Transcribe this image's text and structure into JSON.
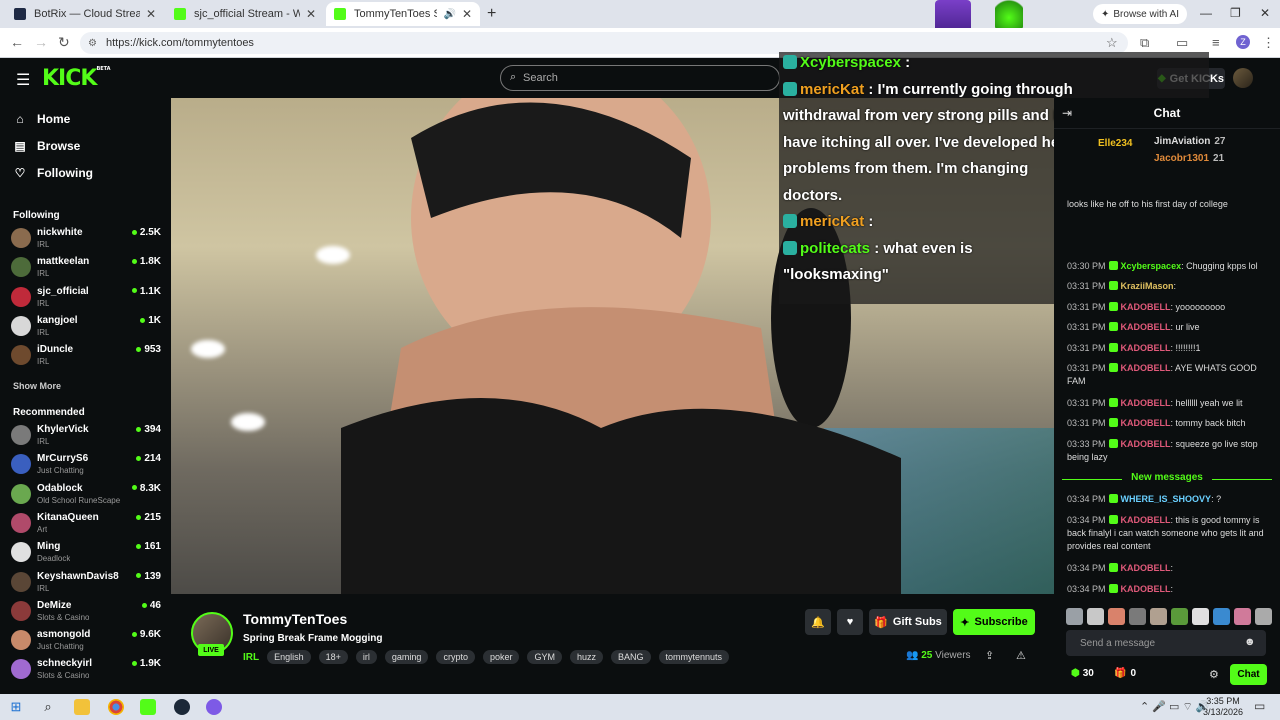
{
  "browser": {
    "tabs": [
      {
        "title": "BotRix — Cloud Streaming Bot",
        "fav_color": "#1f2a44"
      },
      {
        "title": "sjc_official Stream - Watch Live",
        "fav_color": "#53fc18"
      },
      {
        "title": "TommyTenToes Stream - Watch Live",
        "fav_color": "#53fc18"
      }
    ],
    "ai_button": "Browse with AI",
    "url": "https://kick.com/tommytentoes",
    "profile_initial": "Z"
  },
  "kick": {
    "logo": "KICK",
    "logo_beta": "BETA",
    "search_placeholder": "Search",
    "get_kicks": "Get KICKs"
  },
  "sidebar": {
    "nav": [
      "Home",
      "Browse",
      "Following"
    ],
    "following_title": "Following",
    "following": [
      {
        "name": "nickwhite",
        "category": "IRL",
        "viewers": "2.5K",
        "color": "#8a6b4e"
      },
      {
        "name": "mattkeelan",
        "category": "IRL",
        "viewers": "1.8K",
        "color": "#4d6b3a"
      },
      {
        "name": "sjc_official",
        "category": "IRL",
        "viewers": "1.1K",
        "color": "#c02a3a"
      },
      {
        "name": "kangjoel",
        "category": "IRL",
        "viewers": "1K",
        "color": "#d8d8d8"
      },
      {
        "name": "iDuncle",
        "category": "IRL",
        "viewers": "953",
        "color": "#6e4a2e"
      }
    ],
    "show_more": "Show More",
    "recommended_title": "Recommended",
    "recommended": [
      {
        "name": "KhylerVick",
        "category": "IRL",
        "viewers": "394",
        "color": "#7a7a7a"
      },
      {
        "name": "MrCurryS6",
        "category": "Just Chatting",
        "viewers": "214",
        "color": "#3a5fbf"
      },
      {
        "name": "Odablock",
        "category": "Old School RuneScape",
        "viewers": "8.3K",
        "color": "#6aa84f"
      },
      {
        "name": "KitanaQueen",
        "category": "Art",
        "viewers": "215",
        "color": "#b04a6a"
      },
      {
        "name": "Ming",
        "category": "Deadlock",
        "viewers": "161",
        "color": "#e0e0e0"
      },
      {
        "name": "KeyshawnDavis8",
        "category": "IRL",
        "viewers": "139",
        "color": "#5a4636"
      },
      {
        "name": "DeMize",
        "category": "Slots & Casino",
        "viewers": "46",
        "color": "#8b3a3a"
      },
      {
        "name": "asmongold",
        "category": "Just Chatting",
        "viewers": "9.6K",
        "color": "#c88a6a"
      },
      {
        "name": "schneckyirl",
        "category": "Slots & Casino",
        "viewers": "1.9K",
        "color": "#a06ad0"
      }
    ]
  },
  "overlay": {
    "lines": [
      {
        "user": "Xcyberspacex",
        "text": " :",
        "color": "#53fc18"
      },
      {
        "user": "mericKat",
        "text": " : I'm currently going through",
        "color": "#f0a020"
      },
      {
        "user": "",
        "text": "withdrawal from very strong pills and I",
        "color": "#fff"
      },
      {
        "user": "",
        "text": "have itching all over. I've developed heart",
        "color": "#fff"
      },
      {
        "user": "",
        "text": "problems from them. I'm changing",
        "color": "#fff"
      },
      {
        "user": "",
        "text": "doctors.",
        "color": "#fff"
      },
      {
        "user": "mericKat",
        "text": " :",
        "color": "#f0a020"
      },
      {
        "user": "politecats",
        "text": " : what even is",
        "color": "#53fc18"
      },
      {
        "user": "",
        "text": "\"looksmaxing\"",
        "color": "#fff"
      }
    ]
  },
  "stream": {
    "name": "TommyTenToes",
    "title": "Spring Break Frame Mogging",
    "live": "LIVE",
    "category": "IRL",
    "tags": [
      "English",
      "18+",
      "irl",
      "gaming",
      "crypto",
      "poker",
      "GYM",
      "huzz",
      "BANG",
      "tommytennuts"
    ],
    "gift_subs": "Gift Subs",
    "subscribe": "Subscribe",
    "viewers_count": "25",
    "viewers_label": "Viewers"
  },
  "chat": {
    "title": "Chat",
    "gifters": [
      {
        "name": "Elle234",
        "count": "",
        "color": "#f0c020"
      },
      {
        "name": "JimAviation",
        "count": "27",
        "color": "#ddd"
      },
      {
        "name": "Jacobr1301",
        "count": "21",
        "color": "#e08a3a"
      }
    ],
    "messages": [
      {
        "ts": "",
        "user": "",
        "text": "looks like he off to his first day of college",
        "color": "#ddd"
      },
      {
        "ts": "03:30 PM",
        "user": "Xcyberspacex",
        "text": ": Chugging kpps lol",
        "color": "#53fc18"
      },
      {
        "ts": "03:31 PM",
        "user": "KraziiMason",
        "text": ":",
        "color": "#e0c060"
      },
      {
        "ts": "03:31 PM",
        "user": "KADOBELL",
        "text": ": yooooooooo",
        "color": "#e05a7a"
      },
      {
        "ts": "03:31 PM",
        "user": "KADOBELL",
        "text": ": ur live",
        "color": "#e05a7a"
      },
      {
        "ts": "03:31 PM",
        "user": "KADOBELL",
        "text": ": !!!!!!!!1",
        "color": "#e05a7a"
      },
      {
        "ts": "03:31 PM",
        "user": "KADOBELL",
        "text": ": AYE WHATS GOOD FAM",
        "color": "#e05a7a"
      },
      {
        "ts": "03:31 PM",
        "user": "KADOBELL",
        "text": ": hellllll yeah we lit",
        "color": "#e05a7a"
      },
      {
        "ts": "03:31 PM",
        "user": "KADOBELL",
        "text": ": tommy back bitch",
        "color": "#e05a7a"
      },
      {
        "ts": "03:33 PM",
        "user": "KADOBELL",
        "text": ": squeeze go live stop being lazy",
        "color": "#e05a7a"
      }
    ],
    "new_messages_label": "New messages",
    "new_messages": [
      {
        "ts": "03:34 PM",
        "user": "WHERE_IS_SHOOVY",
        "text": ": ?",
        "color": "#6ad0ff"
      },
      {
        "ts": "03:34 PM",
        "user": "KADOBELL",
        "text": ": this is good tommy is back finalyl i can watch someone who gets lit and provides real content",
        "color": "#e05a7a"
      },
      {
        "ts": "03:34 PM",
        "user": "KADOBELL",
        "text": ":",
        "color": "#e05a7a"
      },
      {
        "ts": "03:34 PM",
        "user": "KADOBELL",
        "text": ":",
        "color": "#e05a7a"
      }
    ],
    "input_placeholder": "Send a message",
    "kicks": "30",
    "rewards": "0",
    "send": "Chat"
  },
  "taskbar": {
    "time": "3:35 PM",
    "date": "3/13/2026"
  }
}
